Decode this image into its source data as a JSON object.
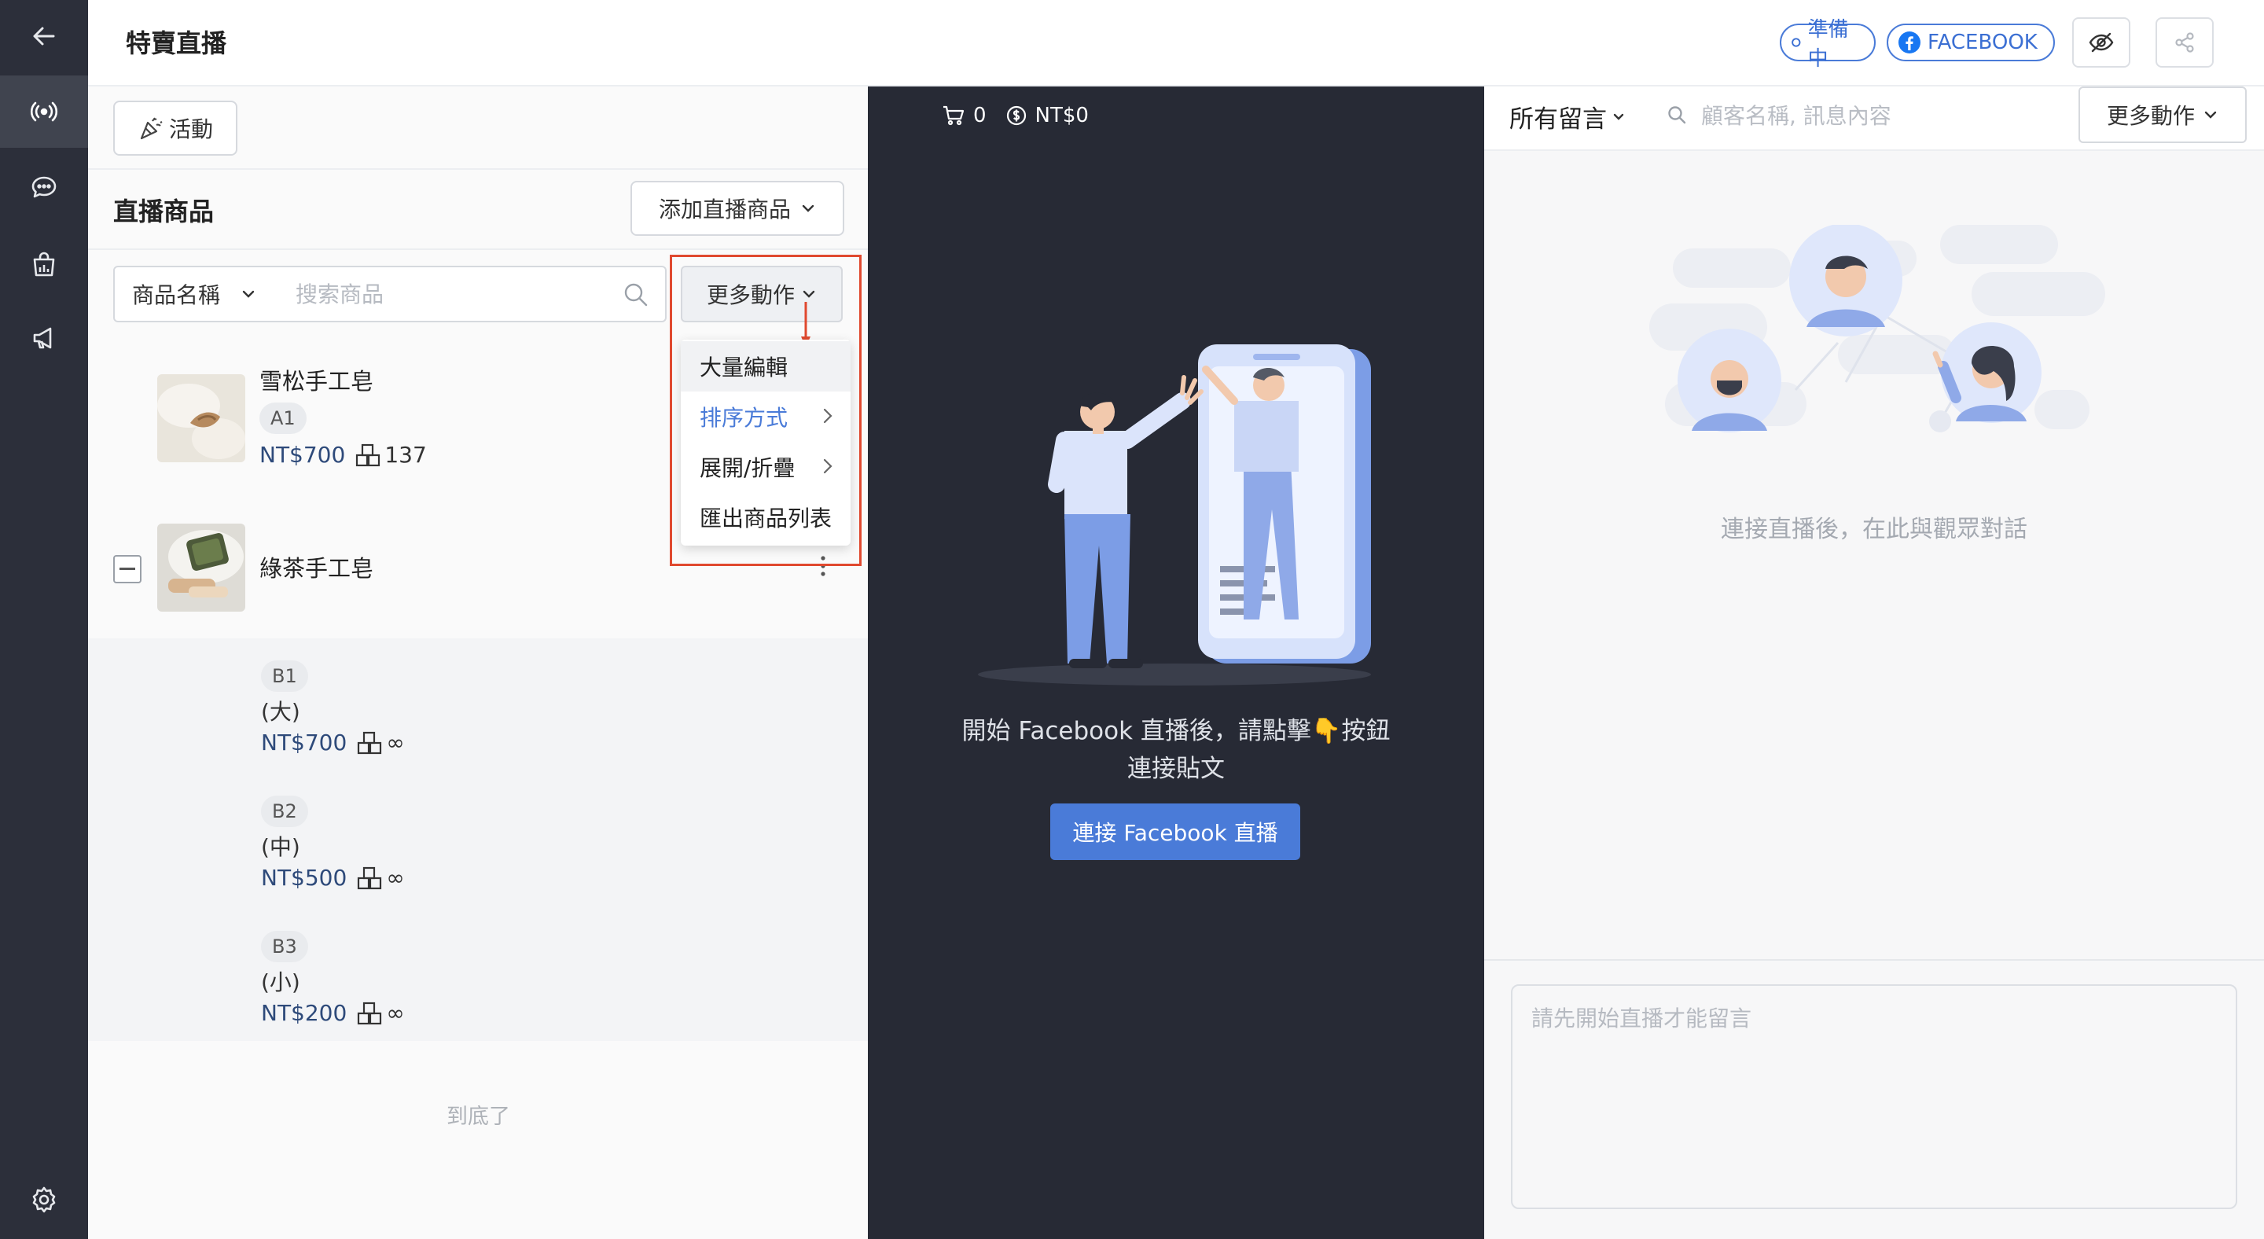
{
  "header": {
    "title": "特賣直播",
    "status_badge": "準備中",
    "platform_badge": "FACEBOOK"
  },
  "left_panel": {
    "activity_button": "活動",
    "section_title": "直播商品",
    "add_product_button": "添加直播商品",
    "filter_select": "商品名稱",
    "search_placeholder": "搜索商品",
    "more_actions_button": "更多動作",
    "menu": {
      "items": [
        {
          "label": "大量編輯"
        },
        {
          "label": "排序方式"
        },
        {
          "label": "展開/折疊"
        },
        {
          "label": "匯出商品列表"
        }
      ]
    },
    "products": [
      {
        "name": "雪松手工皂",
        "tag": "A1",
        "price": "NT$700",
        "stock": "137"
      },
      {
        "name": "綠茶手工皂"
      }
    ],
    "variants": [
      {
        "tag": "B1",
        "label": "(大)",
        "price": "NT$700",
        "stock": "∞"
      },
      {
        "tag": "B2",
        "label": "(中)",
        "price": "NT$500",
        "stock": "∞"
      },
      {
        "tag": "B3",
        "label": "(小)",
        "price": "NT$200",
        "stock": "∞"
      }
    ],
    "end_text": "到底了"
  },
  "stage": {
    "cart_count": "0",
    "revenue": "NT$0",
    "instruction_line1": "開始 Facebook 直播後，請點擊👇按鈕",
    "instruction_line2": "連接貼文",
    "connect_button": "連接 Facebook 直播"
  },
  "right_panel": {
    "filter_label": "所有留言",
    "search_placeholder": "顧客名稱, 訊息內容",
    "more_actions_button": "更多動作",
    "empty_text": "連接直播後，在此與觀眾對話",
    "message_placeholder": "請先開始直播才能留言"
  },
  "colors": {
    "accent": "#4a7bd8",
    "rail": "#2c2f3a",
    "stage": "#272a35",
    "highlight": "#e0492f"
  }
}
